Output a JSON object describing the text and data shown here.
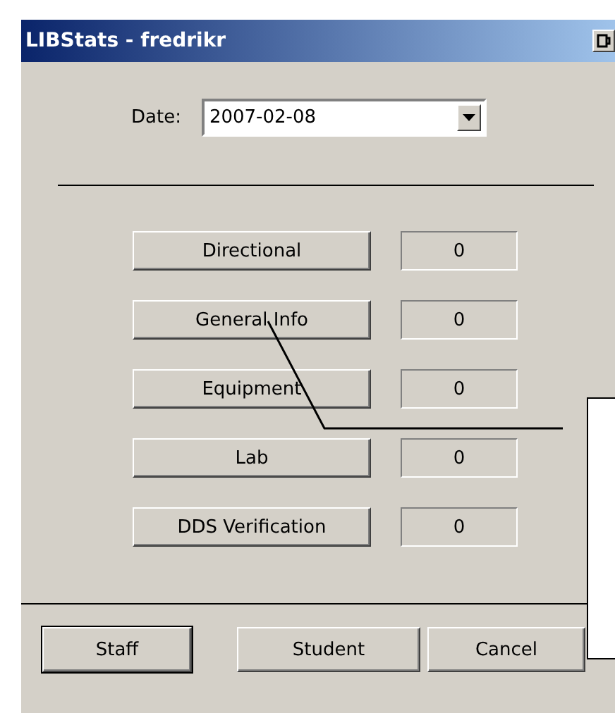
{
  "window": {
    "title": "LIBStats - fredrikr"
  },
  "date": {
    "label": "Date:",
    "value": "2007-02-08"
  },
  "categories": [
    {
      "label": "Directional",
      "count": "0"
    },
    {
      "label": "General Info",
      "count": "0"
    },
    {
      "label": "Equipment",
      "count": "0"
    },
    {
      "label": "Lab",
      "count": "0"
    },
    {
      "label": "DDS Verification",
      "count": "0"
    }
  ],
  "buttons": [
    {
      "label": "Staff",
      "default": true
    },
    {
      "label": "Student",
      "default": false
    },
    {
      "label": "Cancel",
      "default": false
    }
  ]
}
